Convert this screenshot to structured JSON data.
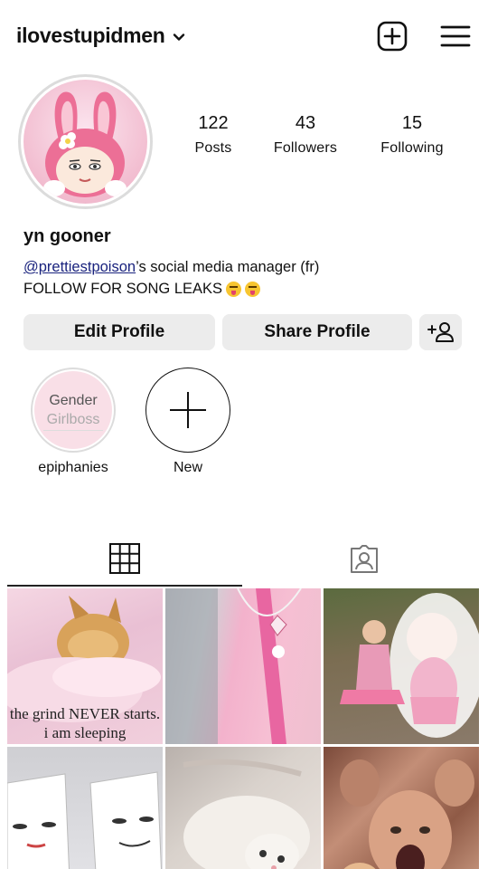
{
  "header": {
    "username": "ilovestupidmen",
    "icons": {
      "dropdown": "chevron-down-icon",
      "new_post": "plus-square-icon",
      "menu": "hamburger-menu-icon"
    }
  },
  "profile": {
    "avatar_icon": "profile-avatar",
    "stats": [
      {
        "value": "122",
        "label": "Posts"
      },
      {
        "value": "43",
        "label": "Followers"
      },
      {
        "value": "15",
        "label": "Following"
      }
    ],
    "display_name": "yn gooner",
    "bio": {
      "mention": "@prettiestpoison",
      "line1_rest": "’s social media manager (fr)",
      "line2": "FOLLOW FOR SONG LEAKS"
    }
  },
  "buttons": {
    "edit_profile": "Edit Profile",
    "share_profile": "Share Profile",
    "add_user_icon": "add-user-icon"
  },
  "highlights": [
    {
      "label": "epiphanies",
      "cover_line1": "Gender",
      "cover_line2": "Girlboss"
    },
    {
      "label": "New"
    }
  ],
  "tabs": {
    "active": "grid",
    "icons": [
      "grid-icon",
      "tagged-icon"
    ]
  },
  "posts": [
    {
      "caption": "the grind NEVER starts. i am sleeping"
    },
    {
      "caption": ""
    },
    {
      "caption": ""
    },
    {
      "caption": ""
    },
    {
      "caption": ""
    },
    {
      "caption": ""
    }
  ],
  "colors": {
    "button_bg": "#ececec",
    "mention": "#1a237e",
    "text": "#111111"
  }
}
